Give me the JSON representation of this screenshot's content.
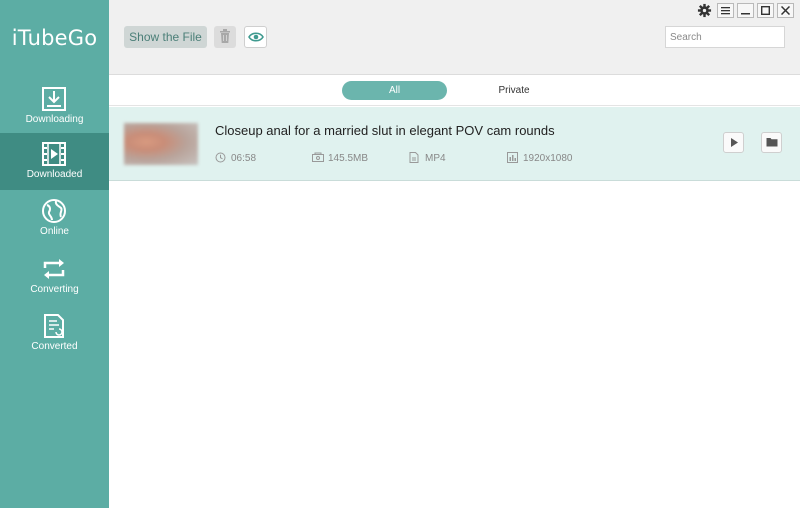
{
  "app": {
    "name": "iTubeGo"
  },
  "sidebar": {
    "items": [
      {
        "label": "Downloading",
        "icon": "download-icon",
        "active": false
      },
      {
        "label": "Downloaded",
        "icon": "film-icon",
        "active": true
      },
      {
        "label": "Online",
        "icon": "globe-icon",
        "active": false
      },
      {
        "label": "Converting",
        "icon": "convert-icon",
        "active": false
      },
      {
        "label": "Converted",
        "icon": "converted-file-icon",
        "active": false
      }
    ]
  },
  "toolbar": {
    "show_file_label": "Show the File",
    "search_placeholder": "Search"
  },
  "tabs": {
    "all": "All",
    "private": "Private",
    "selected": "All"
  },
  "items": [
    {
      "title": "Closeup anal for a married slut in elegant POV cam rounds",
      "duration": "06:58",
      "size": "145.5MB",
      "format": "MP4",
      "resolution": "1920x1080"
    }
  ],
  "colors": {
    "sidebar": "#5cada4",
    "sidebar_active": "#3f8c83",
    "accent": "#6bb5ad",
    "row_selected": "#e0f2ef"
  }
}
